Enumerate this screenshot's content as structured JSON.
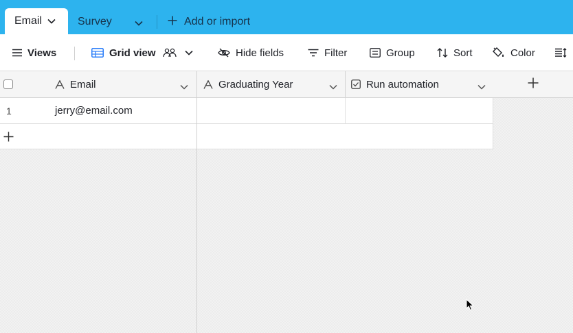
{
  "tabs": {
    "active": {
      "label": "Email"
    },
    "second": {
      "label": "Survey"
    },
    "add": {
      "label": "Add or import"
    }
  },
  "toolbar": {
    "views_label": "Views",
    "grid_view_label": "Grid view",
    "hide_fields_label": "Hide fields",
    "filter_label": "Filter",
    "group_label": "Group",
    "sort_label": "Sort",
    "color_label": "Color"
  },
  "table": {
    "columns": [
      {
        "name": "Email",
        "icon": "text-field-icon"
      },
      {
        "name": "Graduating Year",
        "icon": "text-field-icon"
      },
      {
        "name": "Run automation",
        "icon": "checkbox-field-icon"
      }
    ],
    "rows": [
      {
        "number": "1",
        "email": "jerry@email.com",
        "graduating_year": "",
        "run_automation": ""
      }
    ]
  },
  "colors": {
    "tabbar_bg": "#2db3ee",
    "toolbar_bg": "#ffffff",
    "grid_bg": "#f2f2f2"
  }
}
